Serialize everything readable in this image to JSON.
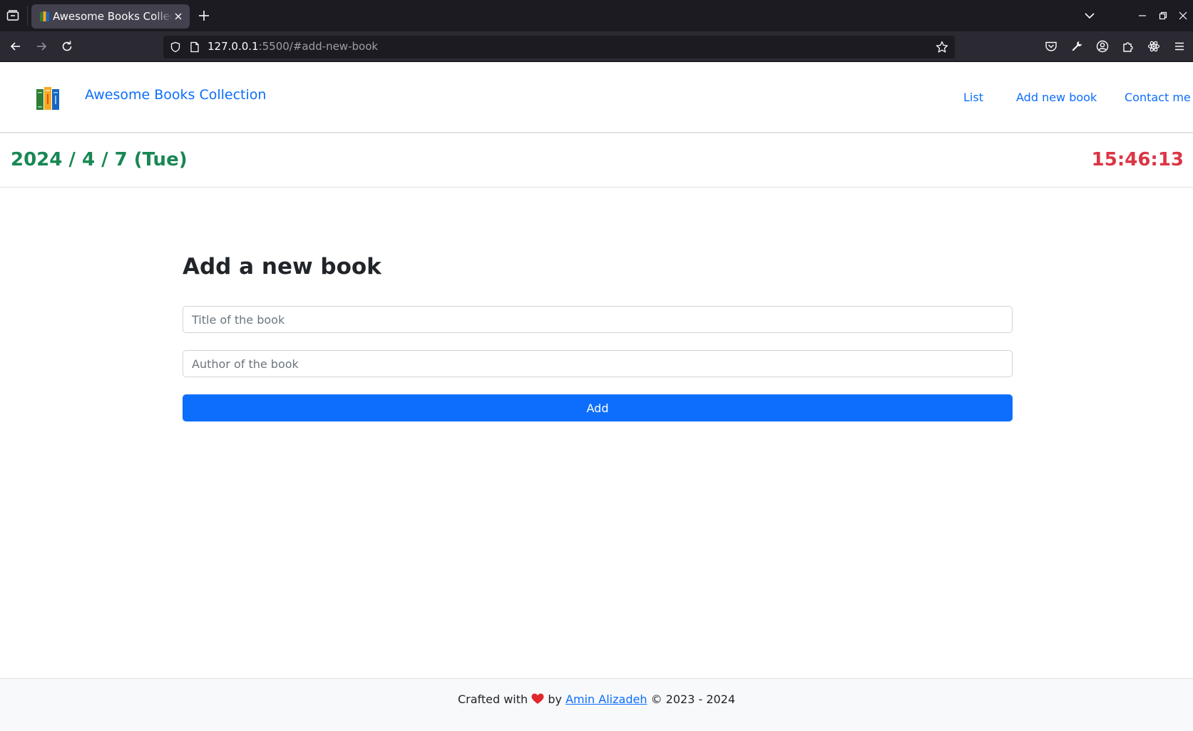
{
  "browser": {
    "tab_title": "Awesome Books Collection",
    "url_host": "127.0.0.1",
    "url_rest": ":5500/#add-new-book"
  },
  "site": {
    "brand": "Awesome Books Collection",
    "nav": {
      "list": "List",
      "add_new": "Add new book",
      "contact": "Contact me"
    }
  },
  "datebar": {
    "date": "2024 / 4 / 7 (Tue)",
    "time": "15:46:13"
  },
  "form": {
    "heading": "Add a new book",
    "title_placeholder": "Title of the book",
    "author_placeholder": "Author of the book",
    "submit_label": "Add"
  },
  "footer": {
    "prefix": "Crafted with",
    "by": "by",
    "author": "Amin Alizadeh",
    "copyright": "© 2023 - 2024"
  },
  "colors": {
    "primary": "#0d6efd",
    "date": "#198754",
    "time": "#dc3545"
  }
}
